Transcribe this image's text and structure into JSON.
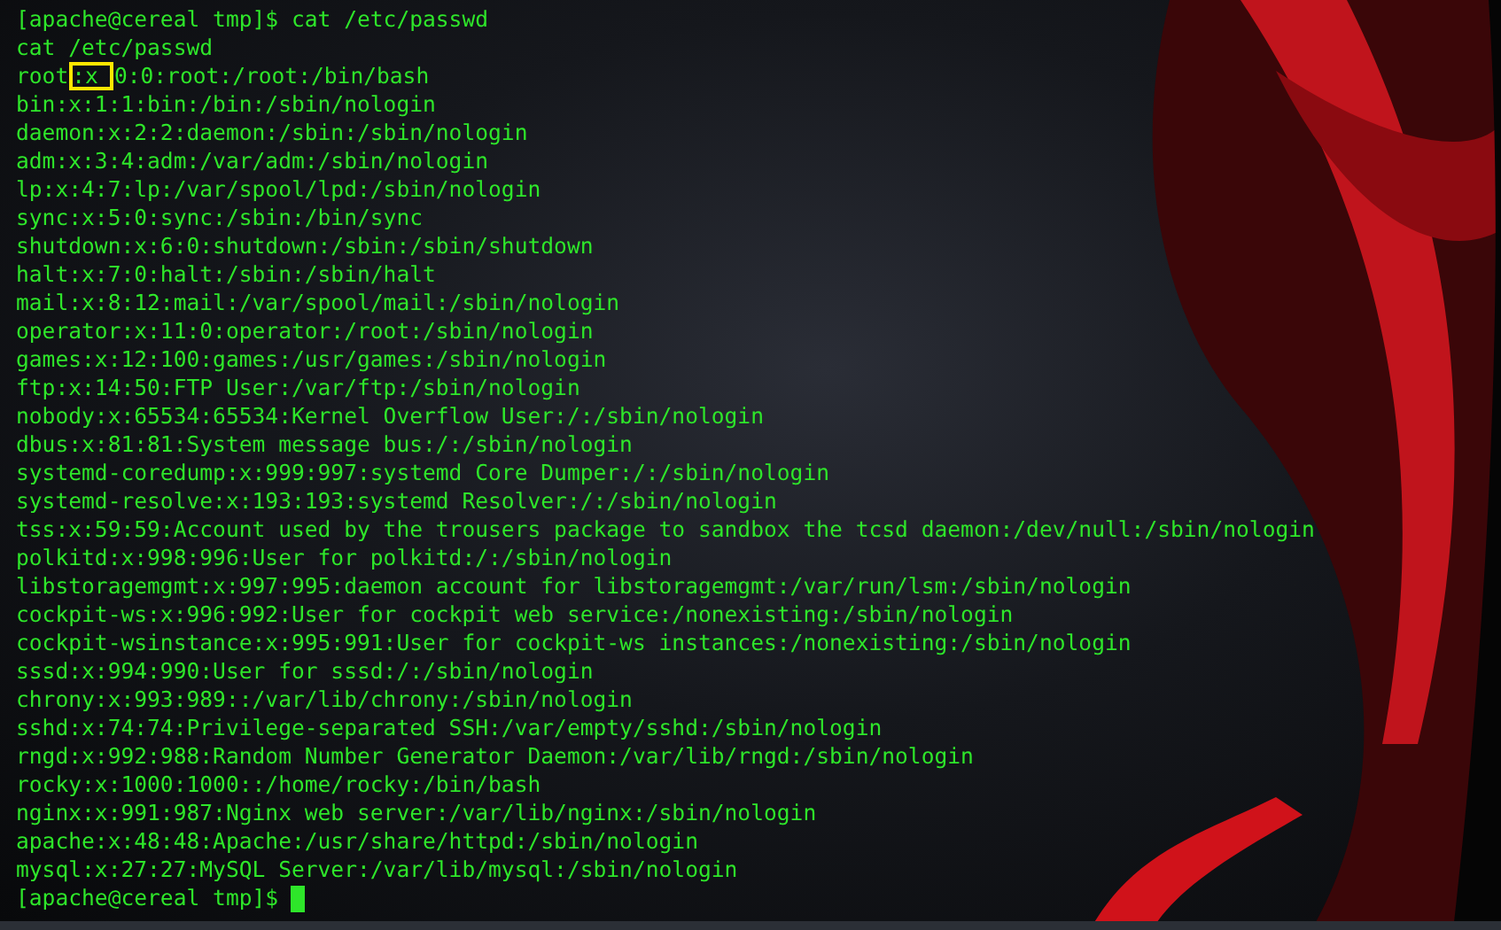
{
  "terminal": {
    "lines": [
      {
        "kind": "plain",
        "text": "[apache@cereal tmp]$ cat /etc/passwd"
      },
      {
        "kind": "plain",
        "text": "cat /etc/passwd"
      },
      {
        "kind": "highlighted",
        "before": "root",
        "marked": ":x",
        "after": "0:0:root:/root:/bin/bash"
      },
      {
        "kind": "plain",
        "text": "bin:x:1:1:bin:/bin:/sbin/nologin"
      },
      {
        "kind": "plain",
        "text": "daemon:x:2:2:daemon:/sbin:/sbin/nologin"
      },
      {
        "kind": "plain",
        "text": "adm:x:3:4:adm:/var/adm:/sbin/nologin"
      },
      {
        "kind": "plain",
        "text": "lp:x:4:7:lp:/var/spool/lpd:/sbin/nologin"
      },
      {
        "kind": "plain",
        "text": "sync:x:5:0:sync:/sbin:/bin/sync"
      },
      {
        "kind": "plain",
        "text": "shutdown:x:6:0:shutdown:/sbin:/sbin/shutdown"
      },
      {
        "kind": "plain",
        "text": "halt:x:7:0:halt:/sbin:/sbin/halt"
      },
      {
        "kind": "plain",
        "text": "mail:x:8:12:mail:/var/spool/mail:/sbin/nologin"
      },
      {
        "kind": "plain",
        "text": "operator:x:11:0:operator:/root:/sbin/nologin"
      },
      {
        "kind": "plain",
        "text": "games:x:12:100:games:/usr/games:/sbin/nologin"
      },
      {
        "kind": "plain",
        "text": "ftp:x:14:50:FTP User:/var/ftp:/sbin/nologin"
      },
      {
        "kind": "plain",
        "text": "nobody:x:65534:65534:Kernel Overflow User:/:/sbin/nologin"
      },
      {
        "kind": "plain",
        "text": "dbus:x:81:81:System message bus:/:/sbin/nologin"
      },
      {
        "kind": "plain",
        "text": "systemd-coredump:x:999:997:systemd Core Dumper:/:/sbin/nologin"
      },
      {
        "kind": "plain",
        "text": "systemd-resolve:x:193:193:systemd Resolver:/:/sbin/nologin"
      },
      {
        "kind": "plain",
        "text": "tss:x:59:59:Account used by the trousers package to sandbox the tcsd daemon:/dev/null:/sbin/nologin"
      },
      {
        "kind": "plain",
        "text": "polkitd:x:998:996:User for polkitd:/:/sbin/nologin"
      },
      {
        "kind": "plain",
        "text": "libstoragemgmt:x:997:995:daemon account for libstoragemgmt:/var/run/lsm:/sbin/nologin"
      },
      {
        "kind": "plain",
        "text": "cockpit-ws:x:996:992:User for cockpit web service:/nonexisting:/sbin/nologin"
      },
      {
        "kind": "plain",
        "text": "cockpit-wsinstance:x:995:991:User for cockpit-ws instances:/nonexisting:/sbin/nologin"
      },
      {
        "kind": "plain",
        "text": "sssd:x:994:990:User for sssd:/:/sbin/nologin"
      },
      {
        "kind": "plain",
        "text": "chrony:x:993:989::/var/lib/chrony:/sbin/nologin"
      },
      {
        "kind": "plain",
        "text": "sshd:x:74:74:Privilege-separated SSH:/var/empty/sshd:/sbin/nologin"
      },
      {
        "kind": "plain",
        "text": "rngd:x:992:988:Random Number Generator Daemon:/var/lib/rngd:/sbin/nologin"
      },
      {
        "kind": "plain",
        "text": "rocky:x:1000:1000::/home/rocky:/bin/bash"
      },
      {
        "kind": "plain",
        "text": "nginx:x:991:987:Nginx web server:/var/lib/nginx:/sbin/nologin"
      },
      {
        "kind": "plain",
        "text": "apache:x:48:48:Apache:/usr/share/httpd:/sbin/nologin"
      },
      {
        "kind": "plain",
        "text": "mysql:x:27:27:MySQL Server:/var/lib/mysql:/sbin/nologin"
      },
      {
        "kind": "prompt",
        "text": "[apache@cereal tmp]$"
      }
    ]
  }
}
